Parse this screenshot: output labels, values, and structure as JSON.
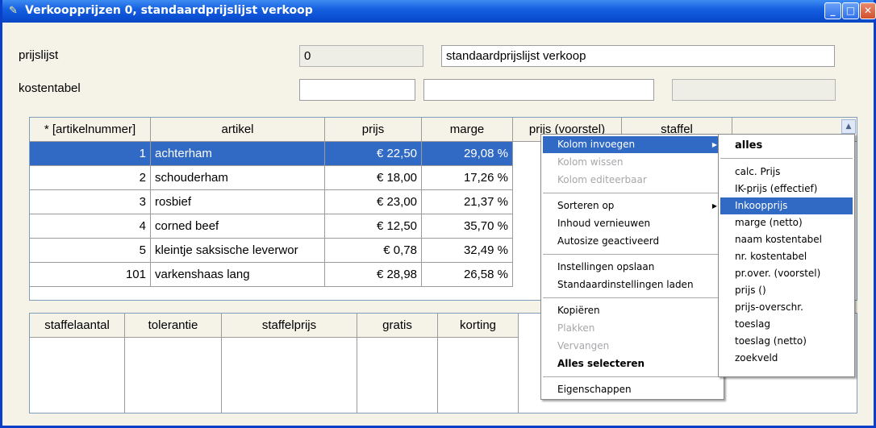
{
  "window": {
    "title": "Verkoopprijzen 0, standaardprijslijst verkoop",
    "min_glyph": "_",
    "max_glyph": "□",
    "close_glyph": "✕"
  },
  "form": {
    "prijslijst_label": "prijslijst",
    "prijslijst_nr": "0",
    "prijslijst_name": "standaardprijslijst verkoop",
    "kostentabel_label": "kostentabel",
    "kostentabel_nr": "",
    "kostentabel_name": "",
    "kostentabel_extra": ""
  },
  "main_grid": {
    "headers": [
      "* [artikelnummer]",
      "artikel",
      "prijs",
      "marge",
      "prijs (voorstel)",
      "staffel"
    ],
    "scroll_up_glyph": "▲",
    "rows": [
      {
        "nr": "1",
        "artikel": "achterham",
        "prijs": "€ 22,50",
        "marge": "29,08 %"
      },
      {
        "nr": "2",
        "artikel": "schouderham",
        "prijs": "€ 18,00",
        "marge": "17,26 %"
      },
      {
        "nr": "3",
        "artikel": "rosbief",
        "prijs": "€ 23,00",
        "marge": "21,37 %"
      },
      {
        "nr": "4",
        "artikel": "corned beef",
        "prijs": "€ 12,50",
        "marge": "35,70 %"
      },
      {
        "nr": "5",
        "artikel": "kleintje saksische leverwor",
        "prijs": "€ 0,78",
        "marge": "32,49 %"
      },
      {
        "nr": "101",
        "artikel": "varkenshaas lang",
        "prijs": "€ 28,98",
        "marge": "26,58 %"
      }
    ]
  },
  "staffel_grid": {
    "headers": [
      "staffelaantal",
      "tolerantie",
      "staffelprijs",
      "gratis",
      "korting"
    ]
  },
  "context_menu": {
    "kolom_invoegen": "Kolom invoegen",
    "kolom_wissen": "Kolom wissen",
    "kolom_editeerbaar": "Kolom editeerbaar",
    "sorteren_op": "Sorteren op",
    "inhoud_vernieuwen": "Inhoud vernieuwen",
    "autosize": "Autosize geactiveerd",
    "instellingen_opslaan": "Instellingen opslaan",
    "standaard_laden": "Standaardinstellingen laden",
    "kopieren": "Kopiëren",
    "plakken": "Plakken",
    "vervangen": "Vervangen",
    "alles_selecteren": "Alles selecteren",
    "eigenschappen": "Eigenschappen",
    "submenu_arrow": "▶"
  },
  "submenu": {
    "alles": "alles",
    "items": [
      "calc. Prijs",
      "IK-prijs (effectief)",
      "Inkoopprijs",
      "marge (netto)",
      "naam kostentabel",
      "nr. kostentabel",
      "pr.over. (voorstel)",
      "prijs ()",
      "prijs-overschr.",
      "toeslag",
      "toeslag (netto)",
      "zoekveld"
    ]
  },
  "colors": {
    "titlebar": "#0a4ed2",
    "selection": "#316ac5",
    "window_bg": "#f5f3e8"
  }
}
